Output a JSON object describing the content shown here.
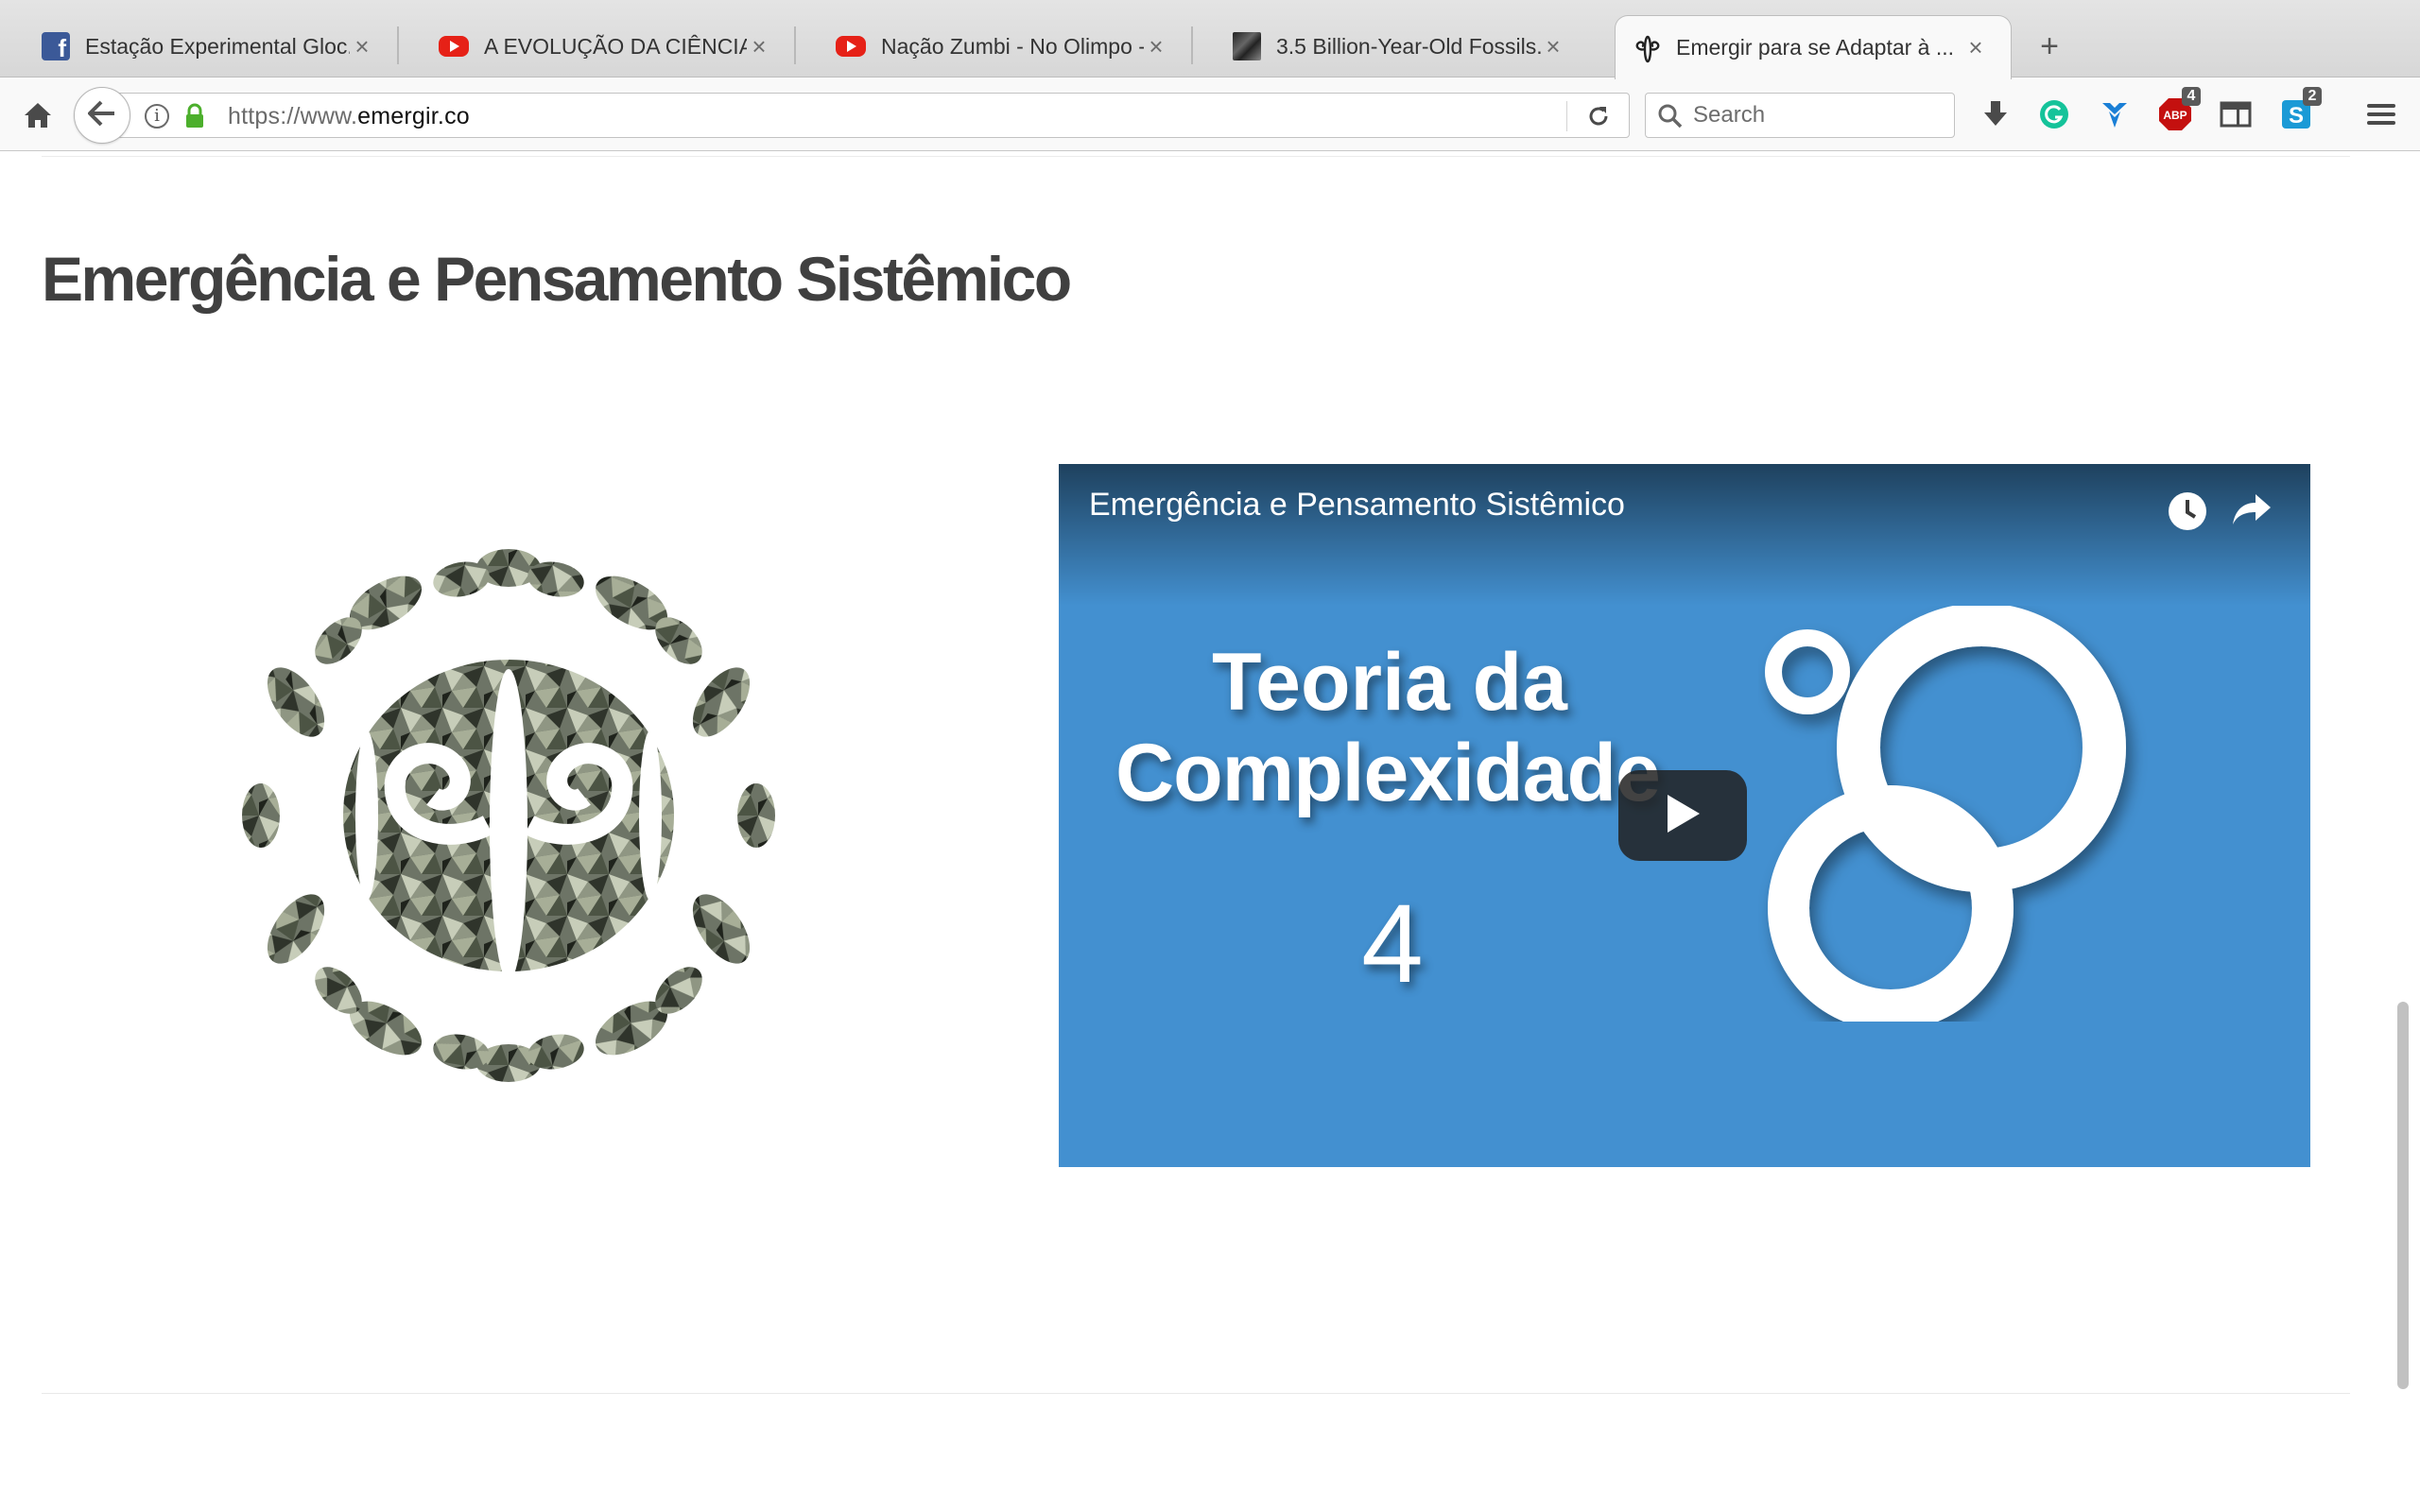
{
  "tabs": [
    {
      "title": "Estação Experimental Gloc...",
      "favicon": "facebook-icon"
    },
    {
      "title": "A EVOLUÇÃO DA CIÊNCIA: ...",
      "favicon": "youtube-icon"
    },
    {
      "title": "Nação Zumbi - No Olimpo -...",
      "favicon": "youtube-icon"
    },
    {
      "title": "3.5 Billion-Year-Old Fossils...",
      "favicon": "fossil-icon"
    },
    {
      "title": "Emergir para se Adaptar à ...",
      "favicon": "emergir-icon",
      "active": true
    }
  ],
  "tab_close_glyph": "×",
  "new_tab_glyph": "+",
  "address": {
    "prefix": "https://www.",
    "host": "emergir.co"
  },
  "search": {
    "placeholder": "Search"
  },
  "toolbar_badges": {
    "adblock": "4",
    "extension": "2"
  },
  "page": {
    "title": "Emergência e Pensamento Sistêmico"
  },
  "video": {
    "title": "Emergência e Pensamento Sistêmico",
    "thumb_line1": "Teoria da",
    "thumb_line2": "Complexidade",
    "thumb_number": "4",
    "background": "#4390d0"
  },
  "colors": {
    "heading": "#404040",
    "video_bg": "#4390d0",
    "secure_lock": "#4caf2c"
  }
}
